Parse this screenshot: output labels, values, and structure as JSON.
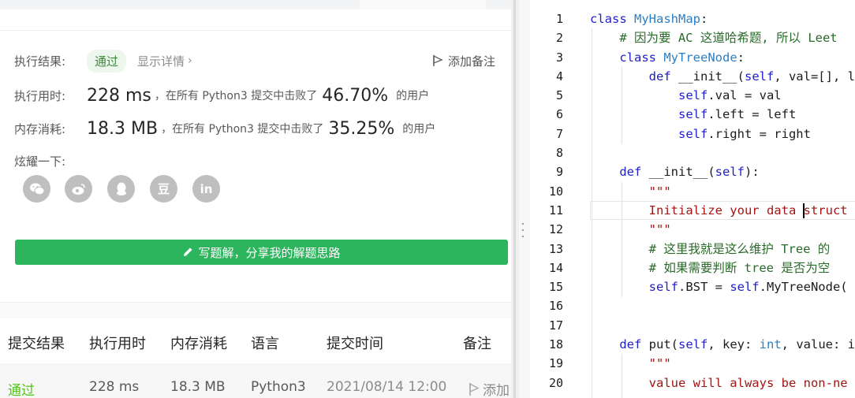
{
  "result": {
    "status_label": "执行结果:",
    "status_value": "通过",
    "details_link": "显示详情",
    "add_note": "添加备注",
    "runtime_label": "执行用时:",
    "runtime_value": "228 ms",
    "runtime_text": "，在所有 Python3 提交中击败了",
    "runtime_pct": "46.70%",
    "runtime_suffix": "的用户",
    "memory_label": "内存消耗:",
    "memory_value": "18.3 MB",
    "memory_text": "，在所有 Python3 提交中击败了",
    "memory_pct": "35.25%",
    "memory_suffix": "的用户",
    "share_label": "炫耀一下:",
    "share_icons": [
      "wechat-icon",
      "weibo-icon",
      "qq-icon",
      "douban-icon",
      "linkedin-icon"
    ],
    "douban_glyph": "豆",
    "linkedin_glyph": "in",
    "write_button": "写题解，分享我的解题思路"
  },
  "submissions": {
    "headers": [
      "提交结果",
      "执行用时",
      "内存消耗",
      "语言",
      "提交时间",
      "备注"
    ],
    "row": {
      "result": "通过",
      "runtime": "228 ms",
      "memory": "18.3 MB",
      "language": "Python3",
      "time": "2021/08/14 12:00",
      "note": "添加"
    }
  },
  "editor": {
    "line_numbers": [
      "1",
      "2",
      "3",
      "4",
      "5",
      "6",
      "7",
      "8",
      "9",
      "10",
      "11",
      "12",
      "13",
      "14",
      "15",
      "16",
      "17",
      "18",
      "19",
      "20"
    ],
    "lines": [
      "class MyHashMap:",
      "    # 因为要 AC 这道哈希题, 所以 Leet",
      "    class MyTreeNode:",
      "        def __init__(self, val=[], l",
      "            self.val = val",
      "            self.left = left",
      "            self.right = right",
      "",
      "    def __init__(self):",
      "        \"\"\"",
      "        Initialize your data struct",
      "        \"\"\"",
      "        # 这里我就是这么维护 Tree 的",
      "        # 如果需要判断 tree 是否为空",
      "        self.BST = self.MyTreeNode(",
      "",
      "",
      "    def put(self, key: int, value: i",
      "        \"\"\"",
      "        value will always be non-ne"
    ],
    "colors": {
      "keyword": "#1e1ec8",
      "class_name": "#2b7fc4",
      "comment": "#2a6a2a",
      "string": "#a31515"
    }
  },
  "colors": {
    "accent_green": "#2db55d",
    "pass_green": "#52c41a"
  }
}
